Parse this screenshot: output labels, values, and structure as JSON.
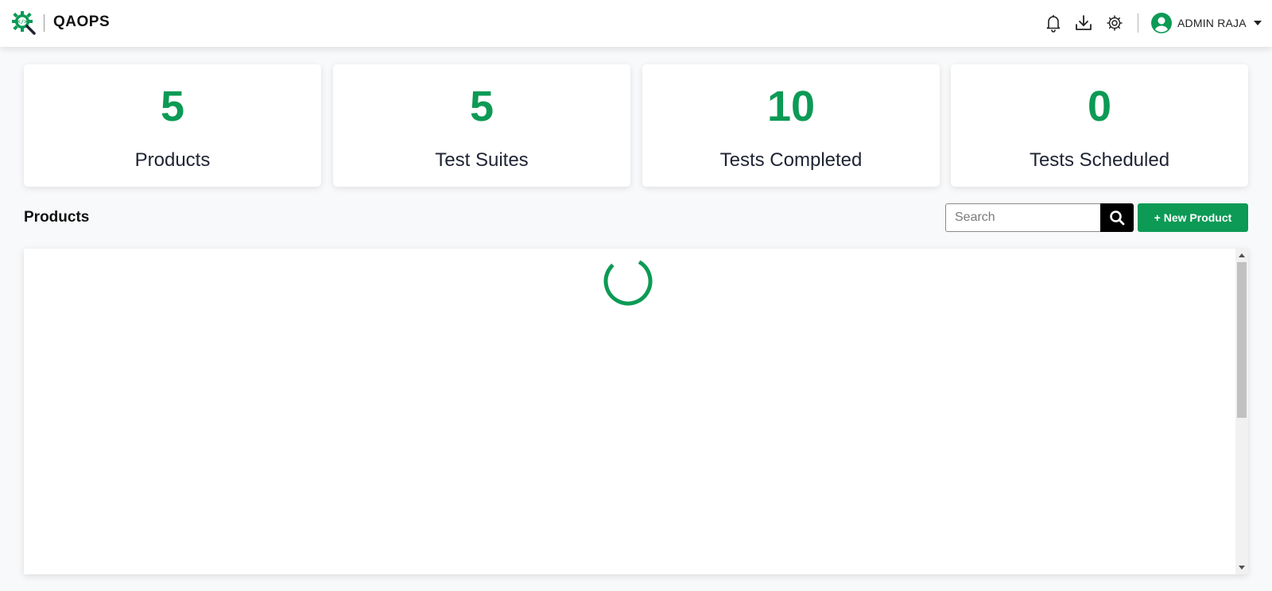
{
  "header": {
    "brand": "QAOPS",
    "user_name": "ADMIN RAJA",
    "icons": [
      "logo-gear-code-icon",
      "bell-icon",
      "download-icon",
      "settings-gear-icon",
      "user-avatar-icon",
      "caret-down-icon"
    ]
  },
  "stats": [
    {
      "value": "5",
      "label": "Products"
    },
    {
      "value": "5",
      "label": "Test Suites"
    },
    {
      "value": "10",
      "label": "Tests Completed"
    },
    {
      "value": "0",
      "label": "Tests Scheduled"
    }
  ],
  "products": {
    "title": "Products",
    "search_placeholder": "Search",
    "new_button_label": "+ New Product",
    "loading": true
  },
  "colors": {
    "accent": "#0c9a55",
    "search_button": "#000000",
    "text_dark": "#1f2433"
  }
}
